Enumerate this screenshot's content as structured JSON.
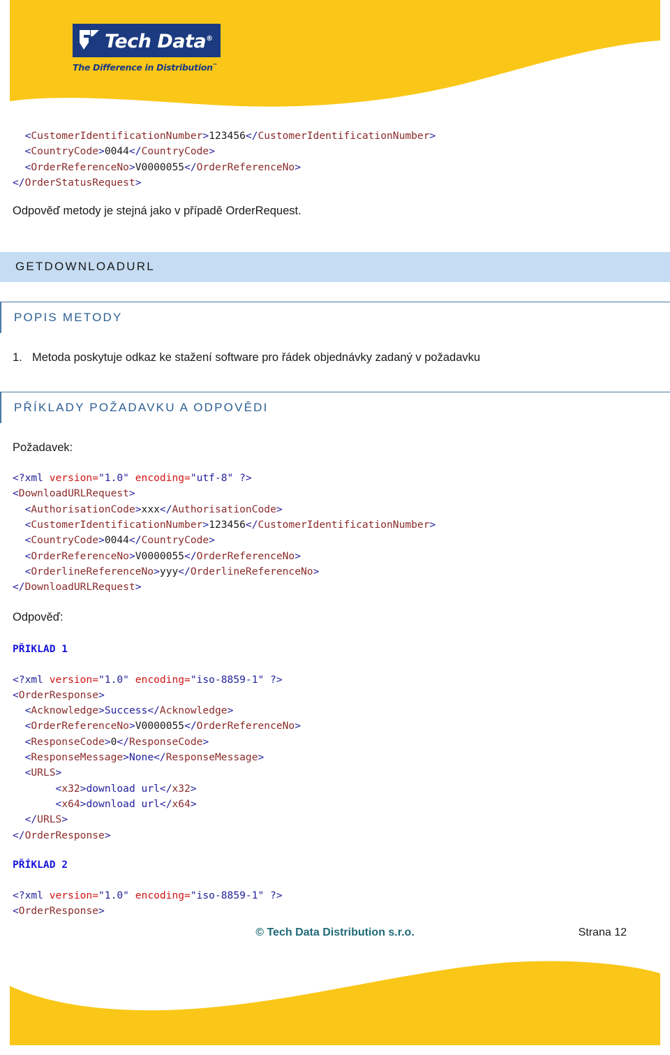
{
  "brand": {
    "logo_word": "Tech Data",
    "logo_registered": "®",
    "tagline": "The Difference in Distribution",
    "tagline_tm": "™",
    "yellow": "#fac718",
    "navy": "#1b3a80"
  },
  "top_code": {
    "lines": [
      [
        {
          "t": "  ",
          "c": "txt"
        },
        {
          "t": "<",
          "c": "brk"
        },
        {
          "t": "CustomerIdentificationNumber",
          "c": "tag"
        },
        {
          "t": ">",
          "c": "brk"
        },
        {
          "t": "123456",
          "c": "txt"
        },
        {
          "t": "</",
          "c": "brk"
        },
        {
          "t": "CustomerIdentificationNumber",
          "c": "tag"
        },
        {
          "t": ">",
          "c": "brk"
        }
      ],
      [
        {
          "t": "  ",
          "c": "txt"
        },
        {
          "t": "<",
          "c": "brk"
        },
        {
          "t": "CountryCode",
          "c": "tag"
        },
        {
          "t": ">",
          "c": "brk"
        },
        {
          "t": "0044",
          "c": "txt"
        },
        {
          "t": "</",
          "c": "brk"
        },
        {
          "t": "CountryCode",
          "c": "tag"
        },
        {
          "t": ">",
          "c": "brk"
        }
      ],
      [
        {
          "t": "  ",
          "c": "txt"
        },
        {
          "t": "<",
          "c": "brk"
        },
        {
          "t": "OrderReferenceNo",
          "c": "tag"
        },
        {
          "t": ">",
          "c": "brk"
        },
        {
          "t": "V0000055",
          "c": "txt"
        },
        {
          "t": "</",
          "c": "brk"
        },
        {
          "t": "OrderReferenceNo",
          "c": "tag"
        },
        {
          "t": ">",
          "c": "brk"
        }
      ],
      [
        {
          "t": "</",
          "c": "brk"
        },
        {
          "t": "OrderStatusRequest",
          "c": "tag"
        },
        {
          "t": ">",
          "c": "brk"
        }
      ]
    ]
  },
  "intro_paragraph": "Odpověď metody je stejná jako v případě OrderRequest.",
  "method_band_title": "GETDOWNLOADURL",
  "description_section": {
    "title": "POPIS METODY",
    "items": [
      {
        "num": "1.",
        "text": "Metoda poskytuje odkaz ke stažení software pro řádek objednávky zadaný v požadavku"
      }
    ]
  },
  "examples_section": {
    "title": "PŘÍKLADY POŽADAVKU A ODPOVĚDI",
    "request_label": "Požadavek:",
    "response_label": "Odpověď:",
    "example1_label": "PŘIKLAD 1",
    "example2_label": "PŘÍKLAD 2"
  },
  "request_code": {
    "lines": [
      [
        {
          "t": "<?xml ",
          "c": "brk"
        },
        {
          "t": "version=",
          "c": "attr"
        },
        {
          "t": "\"1.0\"",
          "c": "astr"
        },
        {
          "t": " ",
          "c": "txt"
        },
        {
          "t": "encoding=",
          "c": "attr"
        },
        {
          "t": "\"utf-8\"",
          "c": "astr"
        },
        {
          "t": " ?>",
          "c": "brk"
        }
      ],
      [
        {
          "t": "<",
          "c": "brk"
        },
        {
          "t": "DownloadURLRequest",
          "c": "tag"
        },
        {
          "t": ">",
          "c": "brk"
        }
      ],
      [
        {
          "t": "  ",
          "c": "txt"
        },
        {
          "t": "<",
          "c": "brk"
        },
        {
          "t": "AuthorisationCode",
          "c": "tag"
        },
        {
          "t": ">",
          "c": "brk"
        },
        {
          "t": "xxx",
          "c": "txt"
        },
        {
          "t": "</",
          "c": "brk"
        },
        {
          "t": "AuthorisationCode",
          "c": "tag"
        },
        {
          "t": ">",
          "c": "brk"
        }
      ],
      [
        {
          "t": "  ",
          "c": "txt"
        },
        {
          "t": "<",
          "c": "brk"
        },
        {
          "t": "CustomerIdentificationNumber",
          "c": "tag"
        },
        {
          "t": ">",
          "c": "brk"
        },
        {
          "t": "123456",
          "c": "txt"
        },
        {
          "t": "</",
          "c": "brk"
        },
        {
          "t": "CustomerIdentificationNumber",
          "c": "tag"
        },
        {
          "t": ">",
          "c": "brk"
        }
      ],
      [
        {
          "t": "  ",
          "c": "txt"
        },
        {
          "t": "<",
          "c": "brk"
        },
        {
          "t": "CountryCode",
          "c": "tag"
        },
        {
          "t": ">",
          "c": "brk"
        },
        {
          "t": "0044",
          "c": "txt"
        },
        {
          "t": "</",
          "c": "brk"
        },
        {
          "t": "CountryCode",
          "c": "tag"
        },
        {
          "t": ">",
          "c": "brk"
        }
      ],
      [
        {
          "t": "  ",
          "c": "txt"
        },
        {
          "t": "<",
          "c": "brk"
        },
        {
          "t": "OrderReferenceNo",
          "c": "tag"
        },
        {
          "t": ">",
          "c": "brk"
        },
        {
          "t": "V0000055",
          "c": "txt"
        },
        {
          "t": "</",
          "c": "brk"
        },
        {
          "t": "OrderReferenceNo",
          "c": "tag"
        },
        {
          "t": ">",
          "c": "brk"
        }
      ],
      [
        {
          "t": "  ",
          "c": "txt"
        },
        {
          "t": "<",
          "c": "brk"
        },
        {
          "t": "OrderlineReferenceNo",
          "c": "tag"
        },
        {
          "t": ">",
          "c": "brk"
        },
        {
          "t": "yyy",
          "c": "txt"
        },
        {
          "t": "</",
          "c": "brk"
        },
        {
          "t": "OrderlineReferenceNo",
          "c": "tag"
        },
        {
          "t": ">",
          "c": "brk"
        }
      ],
      [
        {
          "t": "</",
          "c": "brk"
        },
        {
          "t": "DownloadURLRequest",
          "c": "tag"
        },
        {
          "t": ">",
          "c": "brk"
        }
      ]
    ]
  },
  "response1_code": {
    "lines": [
      [
        {
          "t": "<?xml ",
          "c": "brk"
        },
        {
          "t": "version=",
          "c": "attr"
        },
        {
          "t": "\"1.0\"",
          "c": "astr"
        },
        {
          "t": " ",
          "c": "txt"
        },
        {
          "t": "encoding=",
          "c": "attr"
        },
        {
          "t": "\"iso-8859-1\"",
          "c": "astr"
        },
        {
          "t": " ?>",
          "c": "brk"
        }
      ],
      [
        {
          "t": "<",
          "c": "brk"
        },
        {
          "t": "OrderResponse",
          "c": "tag"
        },
        {
          "t": ">",
          "c": "brk"
        }
      ],
      [
        {
          "t": "  ",
          "c": "txt"
        },
        {
          "t": "<",
          "c": "brk"
        },
        {
          "t": "Acknowledge",
          "c": "tag"
        },
        {
          "t": ">",
          "c": "brk"
        },
        {
          "t": "Success",
          "c": "val"
        },
        {
          "t": "</",
          "c": "brk"
        },
        {
          "t": "Acknowledge",
          "c": "tag"
        },
        {
          "t": ">",
          "c": "brk"
        }
      ],
      [
        {
          "t": "  ",
          "c": "txt"
        },
        {
          "t": "<",
          "c": "brk"
        },
        {
          "t": "OrderReferenceNo",
          "c": "tag"
        },
        {
          "t": ">",
          "c": "brk"
        },
        {
          "t": "V0000055",
          "c": "txt"
        },
        {
          "t": "</",
          "c": "brk"
        },
        {
          "t": "OrderReferenceNo",
          "c": "tag"
        },
        {
          "t": ">",
          "c": "brk"
        }
      ],
      [
        {
          "t": "  ",
          "c": "txt"
        },
        {
          "t": "<",
          "c": "brk"
        },
        {
          "t": "ResponseCode",
          "c": "tag"
        },
        {
          "t": ">",
          "c": "brk"
        },
        {
          "t": "0",
          "c": "txt"
        },
        {
          "t": "</",
          "c": "brk"
        },
        {
          "t": "ResponseCode",
          "c": "tag"
        },
        {
          "t": ">",
          "c": "brk"
        }
      ],
      [
        {
          "t": "  ",
          "c": "txt"
        },
        {
          "t": "<",
          "c": "brk"
        },
        {
          "t": "ResponseMessage",
          "c": "tag"
        },
        {
          "t": ">",
          "c": "brk"
        },
        {
          "t": "None",
          "c": "val"
        },
        {
          "t": "</",
          "c": "brk"
        },
        {
          "t": "ResponseMessage",
          "c": "tag"
        },
        {
          "t": ">",
          "c": "brk"
        }
      ],
      [
        {
          "t": "  ",
          "c": "txt"
        },
        {
          "t": "<",
          "c": "brk"
        },
        {
          "t": "URLS",
          "c": "tag"
        },
        {
          "t": ">",
          "c": "brk"
        }
      ],
      [
        {
          "t": "       ",
          "c": "txt"
        },
        {
          "t": "<",
          "c": "brk"
        },
        {
          "t": "x32",
          "c": "tag"
        },
        {
          "t": ">",
          "c": "brk"
        },
        {
          "t": "download url",
          "c": "val"
        },
        {
          "t": "</",
          "c": "brk"
        },
        {
          "t": "x32",
          "c": "tag"
        },
        {
          "t": ">",
          "c": "brk"
        }
      ],
      [
        {
          "t": "       ",
          "c": "txt"
        },
        {
          "t": "<",
          "c": "brk"
        },
        {
          "t": "x64",
          "c": "tag"
        },
        {
          "t": ">",
          "c": "brk"
        },
        {
          "t": "download url",
          "c": "val"
        },
        {
          "t": "</",
          "c": "brk"
        },
        {
          "t": "x64",
          "c": "tag"
        },
        {
          "t": ">",
          "c": "brk"
        }
      ],
      [
        {
          "t": "  ",
          "c": "txt"
        },
        {
          "t": "</",
          "c": "brk"
        },
        {
          "t": "URLS",
          "c": "tag"
        },
        {
          "t": ">",
          "c": "brk"
        }
      ],
      [
        {
          "t": "</",
          "c": "brk"
        },
        {
          "t": "OrderResponse",
          "c": "tag"
        },
        {
          "t": ">",
          "c": "brk"
        }
      ]
    ]
  },
  "response2_code": {
    "lines": [
      [
        {
          "t": "<?xml ",
          "c": "brk"
        },
        {
          "t": "version=",
          "c": "attr"
        },
        {
          "t": "\"1.0\"",
          "c": "astr"
        },
        {
          "t": " ",
          "c": "txt"
        },
        {
          "t": "encoding=",
          "c": "attr"
        },
        {
          "t": "\"iso-8859-1\"",
          "c": "astr"
        },
        {
          "t": " ?>",
          "c": "brk"
        }
      ],
      [
        {
          "t": "<",
          "c": "brk"
        },
        {
          "t": "OrderResponse",
          "c": "tag"
        },
        {
          "t": ">",
          "c": "brk"
        }
      ]
    ]
  },
  "footer": {
    "copyright": "© Tech Data Distribution s.r.o.",
    "page": "Strana 12"
  }
}
